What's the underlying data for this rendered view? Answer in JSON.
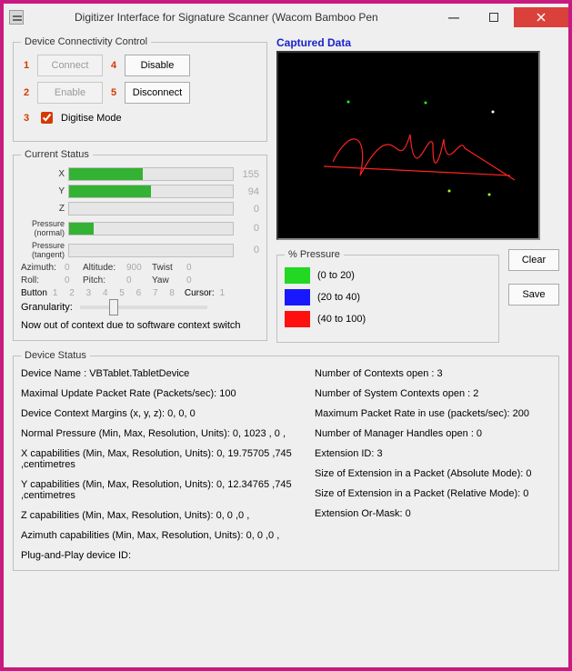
{
  "window": {
    "title": "Digitizer Interface for Signature Scanner (Wacom Bamboo Pen"
  },
  "connectivity": {
    "legend": "Device Connectivity Control",
    "n1": "1",
    "n2": "2",
    "n3": "3",
    "n4": "4",
    "n5": "5",
    "connect": "Connect",
    "enable": "Enable",
    "disable": "Disable",
    "disconnect": "Disconnect",
    "digitise": "Digitise Mode"
  },
  "status": {
    "legend": "Current Status",
    "x_lbl": "X",
    "x_val": "155",
    "x_pct": 45,
    "y_lbl": "Y",
    "y_val": "94",
    "y_pct": 50,
    "z_lbl": "Z",
    "z_val": "0",
    "z_pct": 0,
    "pn_lbl": "Pressure (normal)",
    "pn_val": "0",
    "pn_pct": 15,
    "pt_lbl": "Pressure (tangent)",
    "pt_val": "0",
    "pt_pct": 0,
    "azimuth_lbl": "Azimuth:",
    "azimuth_val": "0",
    "altitude_lbl": "Altitude:",
    "altitude_val": "900",
    "twist_lbl": "Twist",
    "twist_val": "0",
    "roll_lbl": "Roll:",
    "roll_val": "0",
    "pitch_lbl": "Pitch:",
    "pitch_val": "0",
    "yaw_lbl": "Yaw",
    "yaw_val": "0",
    "button_lbl": "Button",
    "button_nums": "1 2 3 4 5 6 7 8",
    "cursor_lbl": "Cursor:",
    "cursor_val": "1",
    "granularity_lbl": "Granularity:",
    "context_msg": "Now out of context due to software context switch"
  },
  "captured": {
    "label": "Captured Data",
    "pressure_legend": "% Pressure",
    "p1": "(0 to 20)",
    "p2": "(20 to 40)",
    "p3": "(40 to 100)",
    "c1": "#22d822",
    "c2": "#1818ff",
    "c3": "#ff1010",
    "clear": "Clear",
    "save": "Save"
  },
  "devstatus": {
    "legend": "Device Status",
    "left": {
      "l1": "Device Name : VBTablet.TabletDevice",
      "l2": "Maximal Update Packet Rate (Packets/sec): 100",
      "l3": "Device Context Margins (x, y, z): 0, 0, 0",
      "l4": "Normal Pressure (Min, Max, Resolution, Units): 0, 1023 , 0 ,",
      "l5": "X capabilities (Min, Max, Resolution, Units): 0, 19.75705 ,745 ,centimetres",
      "l6": "Y capabilities (Min, Max, Resolution, Units): 0, 12.34765 ,745 ,centimetres",
      "l7": "Z capabilities (Min, Max, Resolution, Units): 0, 0 ,0 ,",
      "l8": "Azimuth capabilities (Min, Max, Resolution, Units): 0, 0 ,0 ,",
      "l9": "Plug-and-Play device ID:"
    },
    "right": {
      "r1": "Number of Contexts open : 3",
      "r2": "Number of System Contexts open : 2",
      "r3": "Maximum Packet Rate in use (packets/sec): 200",
      "r4": "Number of Manager Handles open : 0",
      "r5": "Extension ID: 3",
      "r6": "Size of Extension in a Packet (Absolute Mode): 0",
      "r7": "Size of Extension in a Packet (Relative Mode): 0",
      "r8": "Extension Or-Mask: 0"
    }
  }
}
